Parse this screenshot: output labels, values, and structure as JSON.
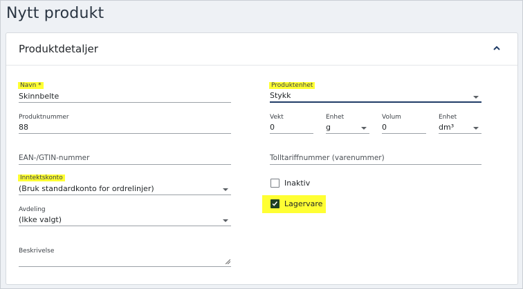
{
  "page": {
    "title": "Nytt produkt"
  },
  "card": {
    "title": "Produktdetaljer",
    "collapse_icon": "chevron-up-icon"
  },
  "form": {
    "name": {
      "label": "Navn *",
      "value": "Skinnbelte"
    },
    "product_number": {
      "label": "Produktnummer",
      "value": "88"
    },
    "ean": {
      "placeholder": "EAN-/GTIN-nummer"
    },
    "income_account": {
      "label": "Inntektskonto",
      "value": "(Bruk standardkonto for ordrelinjer)"
    },
    "department": {
      "label": "Avdeling",
      "value": "(Ikke valgt)"
    },
    "description": {
      "label": "Beskrivelse",
      "value": ""
    },
    "product_unit": {
      "label": "Produktenhet",
      "value": "Stykk"
    },
    "weight": {
      "label": "Vekt",
      "value": "0"
    },
    "weight_unit": {
      "label": "Enhet",
      "value": "g"
    },
    "volume": {
      "label": "Volum",
      "value": "0"
    },
    "volume_unit": {
      "label": "Enhet",
      "value": "dm³"
    },
    "customs_tariff": {
      "placeholder": "Tolltariffnummer (varenummer)"
    },
    "inactive": {
      "label": "Inaktiv",
      "checked": false
    },
    "stock_item": {
      "label": "Lagervare",
      "checked": true
    }
  },
  "colors": {
    "highlight": "#ffff33",
    "accent": "#1f3b66",
    "checkbox_checked": "#1f4023"
  }
}
